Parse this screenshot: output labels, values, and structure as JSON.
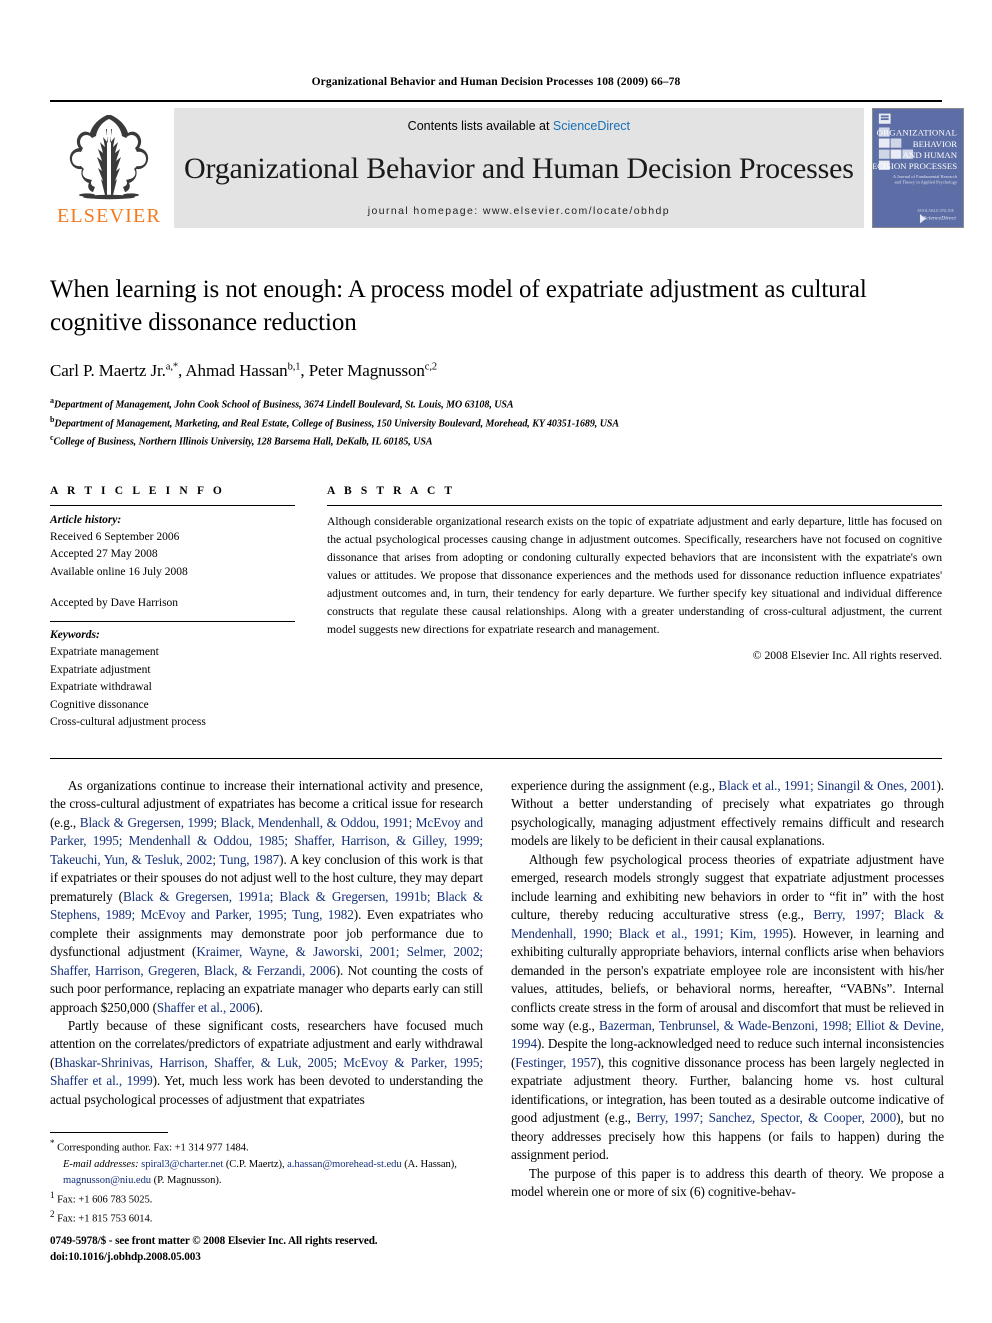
{
  "running_head": "Organizational Behavior and Human Decision Processes 108 (2009) 66–78",
  "masthead": {
    "publisher_name": "ELSEVIER",
    "contents_prefix": "Contents lists available at ",
    "sciencedirect": "ScienceDirect",
    "journal_name": "Organizational Behavior and Human Decision Processes",
    "homepage": "journal homepage: www.elsevier.com/locate/obhdp",
    "cover": {
      "line1": "ORGANIZATIONAL",
      "line2": "BEHAVIOR",
      "line3": "AND HUMAN",
      "line4": "DECISION PROCESSES",
      "subtitle1": "A Journal of Fundamental Research",
      "subtitle2": "and Theory in Applied Psychology",
      "imprint": "ScienceDirect"
    }
  },
  "title": "When learning is not enough: A process model of expatriate adjustment as cultural cognitive dissonance reduction",
  "authors": "Carl P. Maertz Jr. a,*, Ahmad Hassan b,1, Peter Magnusson c,2",
  "affiliations": [
    "a Department of Management, John Cook School of Business, 3674 Lindell Boulevard, St. Louis, MO 63108, USA",
    "b Department of Management, Marketing, and Real Estate, College of Business, 150 University Boulevard, Morehead, KY 40351-1689, USA",
    "c College of Business, Northern Illinois University, 128 Barsema Hall, DeKalb, IL 60185, USA"
  ],
  "article_info": {
    "heading": "A R T I C L E  I N F O",
    "history_label": "Article history:",
    "received": "Received 6 September 2006",
    "accepted": "Accepted 27 May 2008",
    "available_online": "Available online 16 July 2008",
    "accepted_by": "Accepted by Dave Harrison",
    "keywords_label": "Keywords:",
    "keywords": [
      "Expatriate management",
      "Expatriate adjustment",
      "Expatriate withdrawal",
      "Cognitive dissonance",
      "Cross-cultural adjustment process"
    ]
  },
  "abstract": {
    "heading": "A B S T R A C T",
    "text": "Although considerable organizational research exists on the topic of expatriate adjustment and early departure, little has focused on the actual psychological processes causing change in adjustment outcomes. Specifically, researchers have not focused on cognitive dissonance that arises from adopting or condoning culturally expected behaviors that are inconsistent with the expatriate's own values or attitudes. We propose that dissonance experiences and the methods used for dissonance reduction influence expatriates' adjustment outcomes and, in turn, their tendency for early departure. We further specify key situational and individual difference constructs that regulate these causal relationships. Along with a greater understanding of cross-cultural adjustment, the current model suggests new directions for expatriate research and management.",
    "copyright": "© 2008 Elsevier Inc. All rights reserved."
  },
  "body": {
    "left": [
      {
        "segments": [
          {
            "t": "As organizations continue to increase their international activity and presence, the cross-cultural adjustment of expatriates has become a critical issue for research (e.g., "
          },
          {
            "t": "Black & Gregersen, 1999; Black, Mendenhall, & Oddou, 1991; McEvoy and Parker, 1995; Mendenhall & Oddou, 1985; Shaffer, Harrison, & Gilley, 1999; Takeuchi, Yun, & Tesluk, 2002; Tung, 1987",
            "c": true
          },
          {
            "t": "). A key conclusion of this work is that if expatriates or their spouses do not adjust well to the host culture, they may depart prematurely ("
          },
          {
            "t": "Black & Gregersen, 1991a; Black & Gregersen, 1991b; Black & Stephens, 1989; McEvoy and Parker, 1995; Tung, 1982",
            "c": true
          },
          {
            "t": "). Even expatriates who complete their assignments may demonstrate poor job performance due to dysfunctional adjustment ("
          },
          {
            "t": "Kraimer, Wayne, & Jaworski, 2001; Selmer, 2002; Shaffer, Harrison, Gregeren, Black, & Ferzandi, 2006",
            "c": true
          },
          {
            "t": "). Not counting the costs of such poor performance, replacing an expatriate manager who departs early can still approach $250,000 ("
          },
          {
            "t": "Shaffer et al., 2006",
            "c": true
          },
          {
            "t": ")."
          }
        ]
      },
      {
        "segments": [
          {
            "t": "Partly because of these significant costs, researchers have focused much attention on the correlates/predictors of expatriate adjustment and early withdrawal ("
          },
          {
            "t": "Bhaskar-Shrinivas, Harrison, Shaffer, & Luk, 2005; McEvoy & Parker, 1995; Shaffer et al., 1999",
            "c": true
          },
          {
            "t": "). Yet, much less work has been devoted to understanding the actual psychological processes of adjustment that expatriates"
          }
        ]
      }
    ],
    "right": [
      {
        "noindent": true,
        "segments": [
          {
            "t": "experience during the assignment (e.g., "
          },
          {
            "t": "Black et al., 1991; Sinangil & Ones, 2001",
            "c": true
          },
          {
            "t": "). Without a better understanding of precisely what expatriates go through psychologically, managing adjustment effectively remains difficult and research models are likely to be deficient in their causal explanations."
          }
        ]
      },
      {
        "segments": [
          {
            "t": "Although few psychological process theories of expatriate adjustment have emerged, research models strongly suggest that expatriate adjustment processes include learning and exhibiting new behaviors in order to “fit in” with the host culture, thereby reducing acculturative stress (e.g., "
          },
          {
            "t": "Berry, 1997; Black & Mendenhall, 1990; Black et al., 1991; Kim, 1995",
            "c": true
          },
          {
            "t": "). However, in learning and exhibiting culturally appropriate behaviors, internal conflicts arise when behaviors demanded in the person's expatriate employee role are inconsistent with his/her values, attitudes, beliefs, or behavioral norms, hereafter, “VABNs”. Internal conflicts create stress in the form of arousal and discomfort that must be relieved in some way (e.g., "
          },
          {
            "t": "Bazerman, Tenbrunsel, & Wade-Benzoni, 1998; Elliot & Devine, 1994",
            "c": true
          },
          {
            "t": "). Despite the long-acknowledged need to reduce such internal inconsistencies ("
          },
          {
            "t": "Festinger, 1957",
            "c": true
          },
          {
            "t": "), this cognitive dissonance process has been largely neglected in expatriate adjustment theory. Further, balancing home vs. host cultural identifications, or integration, has been touted as a desirable outcome indicative of good adjustment (e.g., "
          },
          {
            "t": "Berry, 1997; Sanchez, Spector, & Cooper, 2000",
            "c": true
          },
          {
            "t": "), but no theory addresses precisely how this happens (or fails to happen) during the assignment period."
          }
        ]
      },
      {
        "segments": [
          {
            "t": "The purpose of this paper is to address this dearth of theory. We propose a model wherein one or more of six (6) cognitive-behav-"
          }
        ]
      }
    ]
  },
  "footnotes": {
    "corresponding": "Corresponding author. Fax: +1 314 977 1484.",
    "email_label": "E-mail addresses:",
    "email1": "spiral3@charter.net",
    "email1_owner": " (C.P. Maertz), ",
    "email2": "a.hassan@morehead-st.edu",
    "email2_owner": " (A. Hassan), ",
    "email3": "magnusson@niu.edu",
    "email3_owner": " (P. Magnusson).",
    "fn1": "Fax: +1 606 783 5025.",
    "fn2": "Fax: +1 815 753 6014."
  },
  "issn_footer": {
    "line1": "0749-5978/$ - see front matter © 2008 Elsevier Inc. All rights reserved.",
    "line2": "doi:10.1016/j.obhdp.2008.05.003"
  },
  "colors": {
    "citation_blue": "#14307a",
    "link_blue": "#1a6fb5",
    "elsevier_orange": "#F47920",
    "masthead_gray": "#e3e3e3"
  }
}
